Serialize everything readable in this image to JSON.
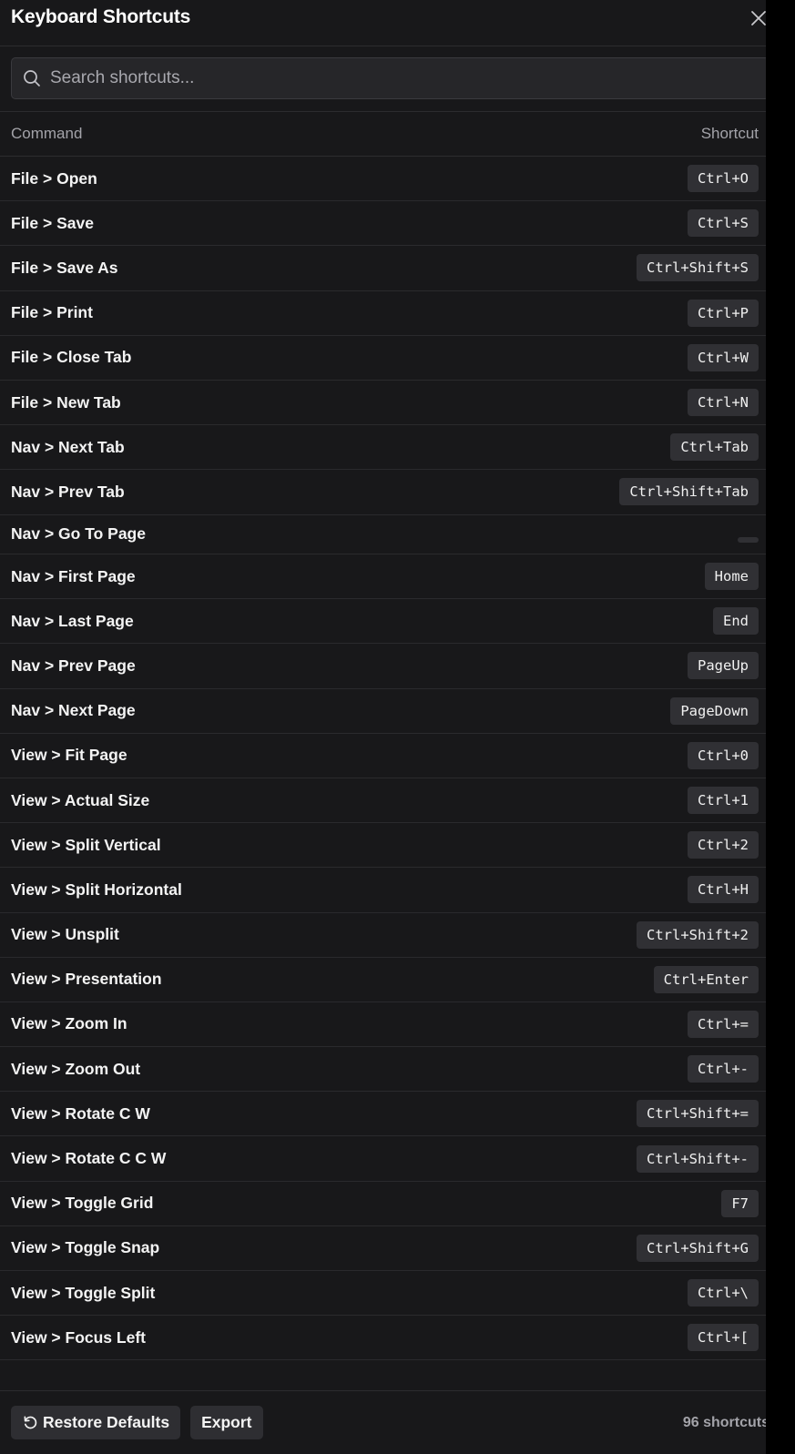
{
  "header": {
    "title": "Keyboard Shortcuts",
    "close_icon": "close-icon"
  },
  "search": {
    "placeholder": "Search shortcuts...",
    "value": "",
    "icon": "search-icon"
  },
  "table": {
    "col_command": "Command",
    "col_shortcut": "Shortcut",
    "rows": [
      {
        "command": "File > Open",
        "shortcut": "Ctrl+O"
      },
      {
        "command": "File > Save",
        "shortcut": "Ctrl+S"
      },
      {
        "command": "File > Save As",
        "shortcut": "Ctrl+Shift+S"
      },
      {
        "command": "File > Print",
        "shortcut": "Ctrl+P"
      },
      {
        "command": "File > Close Tab",
        "shortcut": "Ctrl+W"
      },
      {
        "command": "File > New Tab",
        "shortcut": "Ctrl+N"
      },
      {
        "command": "Nav > Next Tab",
        "shortcut": "Ctrl+Tab"
      },
      {
        "command": "Nav > Prev Tab",
        "shortcut": "Ctrl+Shift+Tab"
      },
      {
        "command": "Nav > Go To Page",
        "shortcut": ""
      },
      {
        "command": "Nav > First Page",
        "shortcut": "Home"
      },
      {
        "command": "Nav > Last Page",
        "shortcut": "End"
      },
      {
        "command": "Nav > Prev Page",
        "shortcut": "PageUp"
      },
      {
        "command": "Nav > Next Page",
        "shortcut": "PageDown"
      },
      {
        "command": "View > Fit Page",
        "shortcut": "Ctrl+0"
      },
      {
        "command": "View > Actual Size",
        "shortcut": "Ctrl+1"
      },
      {
        "command": "View > Split Vertical",
        "shortcut": "Ctrl+2"
      },
      {
        "command": "View > Split Horizontal",
        "shortcut": "Ctrl+H"
      },
      {
        "command": "View > Unsplit",
        "shortcut": "Ctrl+Shift+2"
      },
      {
        "command": "View > Presentation",
        "shortcut": "Ctrl+Enter"
      },
      {
        "command": "View > Zoom In",
        "shortcut": "Ctrl+="
      },
      {
        "command": "View > Zoom Out",
        "shortcut": "Ctrl+-"
      },
      {
        "command": "View > Rotate C W",
        "shortcut": "Ctrl+Shift+="
      },
      {
        "command": "View > Rotate C C W",
        "shortcut": "Ctrl+Shift+-"
      },
      {
        "command": "View > Toggle Grid",
        "shortcut": "F7"
      },
      {
        "command": "View > Toggle Snap",
        "shortcut": "Ctrl+Shift+G"
      },
      {
        "command": "View > Toggle Split",
        "shortcut": "Ctrl+\\"
      },
      {
        "command": "View > Focus Left",
        "shortcut": "Ctrl+["
      }
    ]
  },
  "footer": {
    "restore_label": "Restore Defaults",
    "restore_icon": "restore-icon",
    "export_label": "Export",
    "count_text": "96 shortcuts"
  },
  "colors": {
    "background": "#18181a",
    "key_badge": "#303034",
    "muted_text": "#a3a3a9"
  }
}
